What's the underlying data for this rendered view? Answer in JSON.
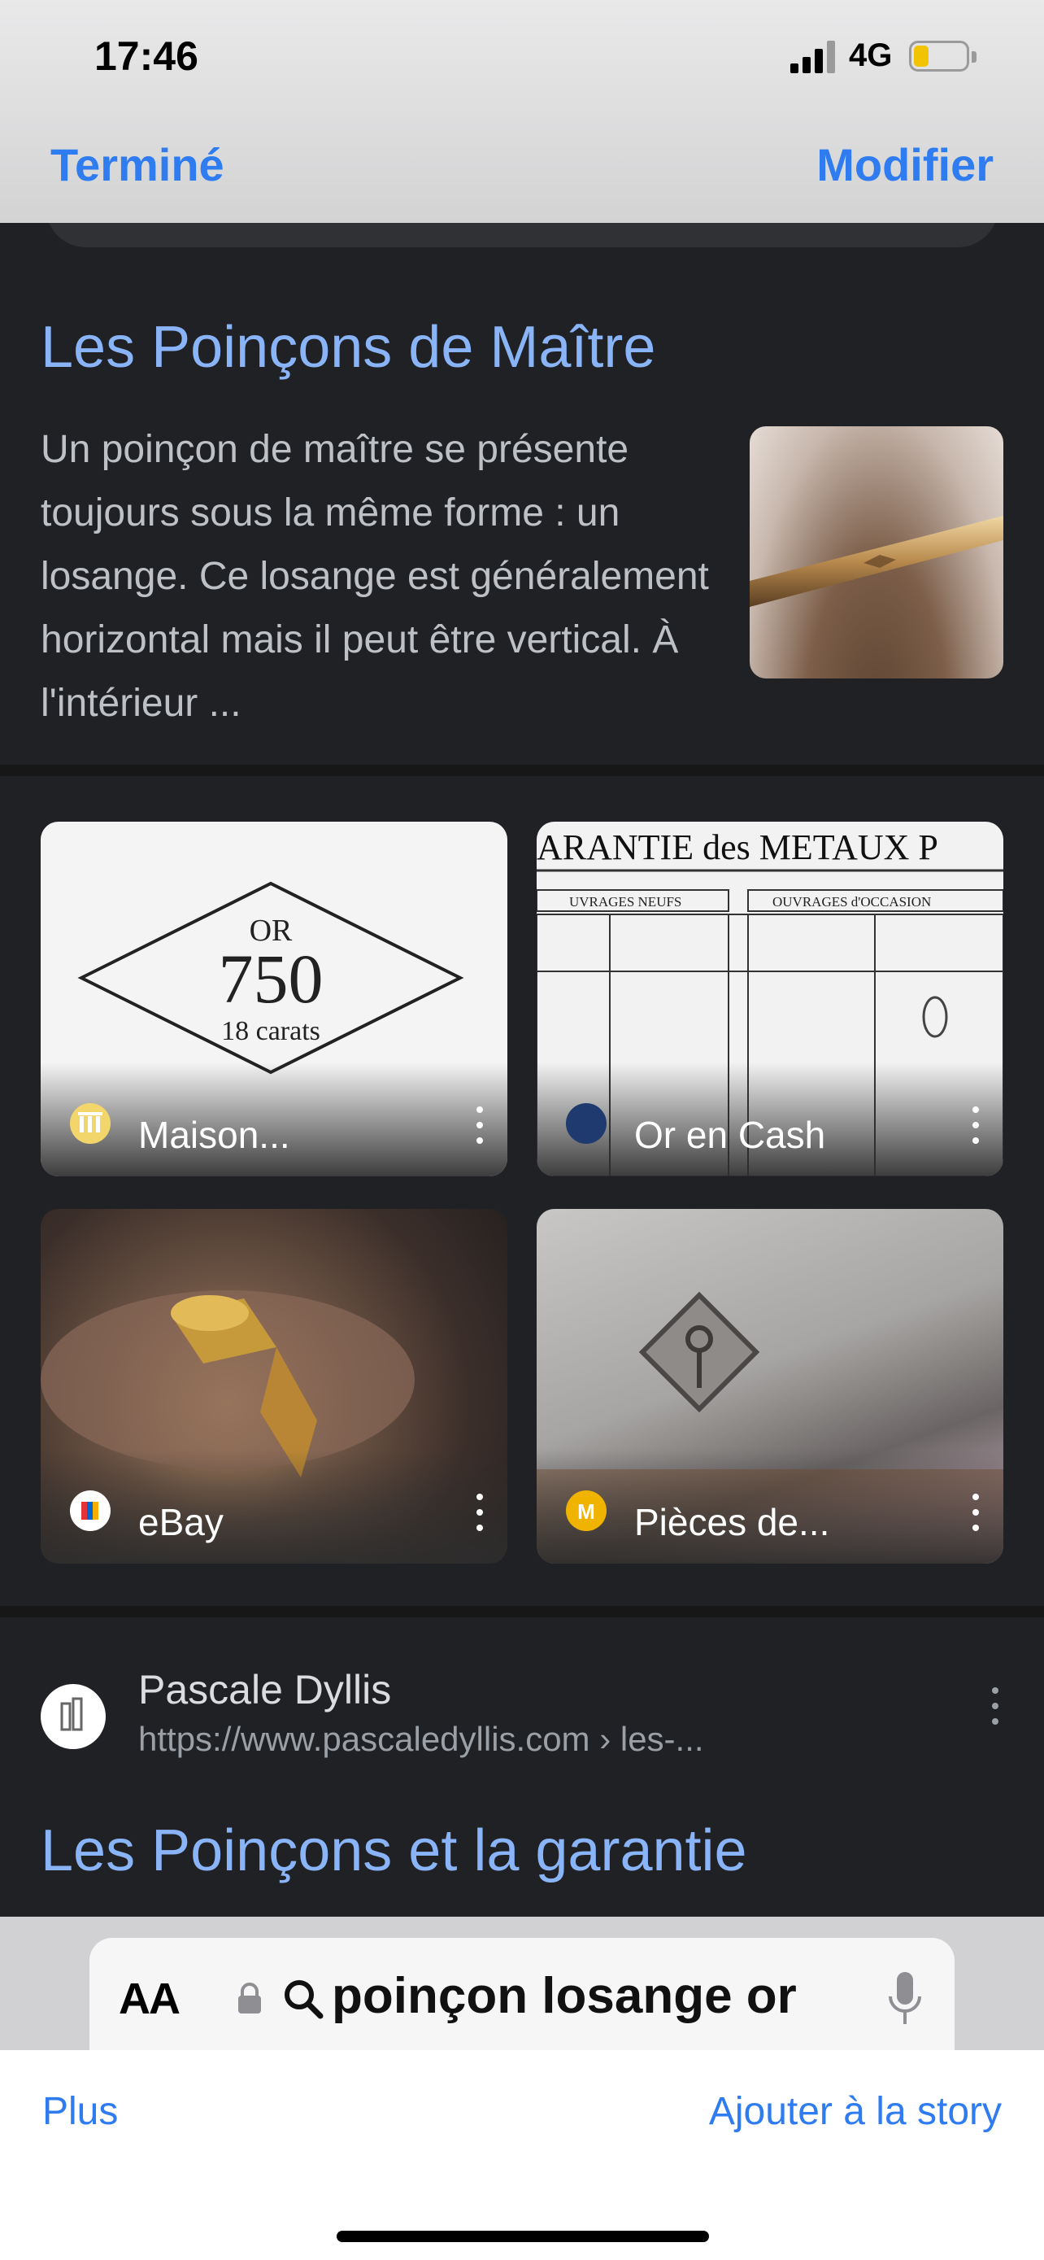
{
  "status_bar": {
    "time": "17:46",
    "network": "4G"
  },
  "header": {
    "left_button": "Terminé",
    "right_button": "Modifier"
  },
  "result1": {
    "title": "Les Poinçons de Maître",
    "snippet": "Un poinçon de maître se présente toujours sous la même forme : un losange. Ce losange est généralement horizontal mais il peut être vertical. À l'intérieur ..."
  },
  "images": [
    {
      "label": "Maison...",
      "icon": "museum-icon",
      "art": {
        "top": "OR",
        "mid": "750",
        "bot": "18 carats"
      }
    },
    {
      "label": "Or en Cash",
      "icon": "or-en-cash-logo-icon",
      "art": {
        "banner": "ARANTIE des METAUX P",
        "col1": "UVRAGES NEUFS",
        "col2": "OUVRAGES d'OCCASION"
      }
    },
    {
      "label": "eBay",
      "icon": "ebay-logo-icon"
    },
    {
      "label": "Pièces de...",
      "icon": "m-logo-icon"
    }
  ],
  "result2": {
    "site_name": "Pascale Dyllis",
    "url": "https://www.pascaledyllis.com › les-...",
    "title": "Les Poinçons et la garantie"
  },
  "url_bar": {
    "aa": "AA",
    "query": "poinçon losange or"
  },
  "toolbar": {
    "left": "Plus",
    "right": "Ajouter à la story"
  },
  "colors": {
    "link_blue": "#8ab4f8",
    "ios_blue": "#2f7bf0",
    "page_bg": "#202124"
  }
}
